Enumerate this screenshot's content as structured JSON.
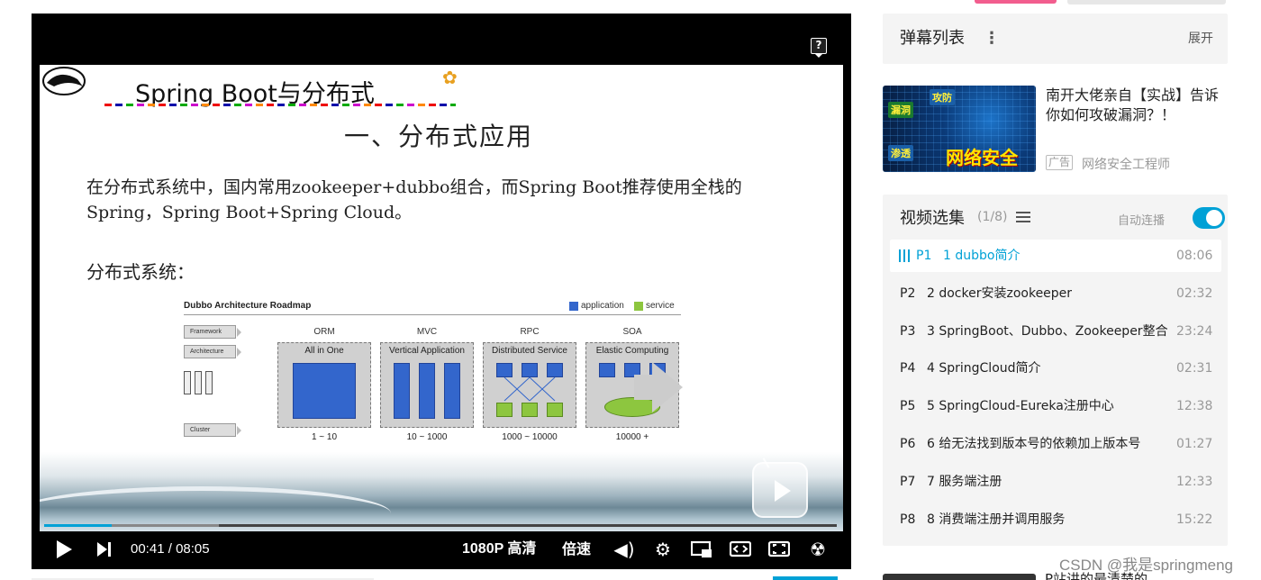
{
  "player": {
    "slide": {
      "title": "Spring Boot与分布式",
      "heading": "一、分布式应用",
      "paragraph": "在分布式系统中，国内常用zookeeper+dubbo组合，而Spring Boot推荐使用全栈的Spring，Spring Boot+Spring Cloud。",
      "subheading": "分布式系统：",
      "diagram": {
        "title": "Dubbo Architecture Roadmap",
        "legend": [
          {
            "label": "application",
            "color": "#3366cc"
          },
          {
            "label": "service",
            "color": "#8dc63f"
          }
        ],
        "side_tags": [
          "Framework",
          "Architecture",
          "Cluster"
        ],
        "stages": [
          {
            "name": "ORM",
            "label": "All in One",
            "range": "1 ~ 10"
          },
          {
            "name": "MVC",
            "label": "Vertical Application",
            "range": "10 ~ 1000"
          },
          {
            "name": "RPC",
            "label": "Distributed Service",
            "range": "1000 ~ 10000"
          },
          {
            "name": "SOA",
            "label": "Elastic Computing",
            "range": "10000 +"
          }
        ]
      }
    },
    "help_label": "?",
    "progress": {
      "played_fraction": 0.085,
      "buffered_fraction": 0.22
    },
    "current_time": "00:41",
    "time_separator": "/",
    "duration": "08:05",
    "quality": "1080P 高清",
    "speed": "倍速",
    "icons": [
      "play-icon",
      "next-icon",
      "volume-icon",
      "settings-icon",
      "picture-in-picture-icon",
      "widescreen-icon",
      "web-fullscreen-icon",
      "fullscreen-icon"
    ]
  },
  "danmaku": {
    "title": "弹幕列表",
    "more": "⋮",
    "expand": "展开"
  },
  "ad": {
    "title": "南开大佬亲自【实战】告诉你如何攻破漏洞？！",
    "badge": "广告",
    "source": "网络安全工程师",
    "thumb_tags": [
      "漏洞",
      "攻防",
      "渗透"
    ],
    "thumb_banner": "网络安全"
  },
  "collection": {
    "title": "视频选集",
    "count": "(1/8)",
    "autoplay_label": "自动连播",
    "autoplay_on": true,
    "episodes": [
      {
        "no": "P1",
        "title": "1 dubbo简介",
        "duration": "08:06",
        "active": true
      },
      {
        "no": "P2",
        "title": "2 docker安装zookeeper",
        "duration": "02:32"
      },
      {
        "no": "P3",
        "title": "3 SpringBoot、Dubbo、Zookeeper整合",
        "duration": "23:24"
      },
      {
        "no": "P4",
        "title": "4 SpringCloud简介",
        "duration": "02:31"
      },
      {
        "no": "P5",
        "title": "5 SpringCloud-Eureka注册中心",
        "duration": "12:38"
      },
      {
        "no": "P6",
        "title": "6 给无法找到版本号的依赖加上版本号",
        "duration": "01:27"
      },
      {
        "no": "P7",
        "title": "7 服务端注册",
        "duration": "12:33"
      },
      {
        "no": "P8",
        "title": "8 消费端注册并调用服务",
        "duration": "15:22"
      }
    ]
  },
  "watermark": "CSDN @我是springmeng",
  "below_text": "P站讲的最清楚的",
  "colors": {
    "accent": "#00a1d6",
    "pink": "#f25d8e"
  }
}
